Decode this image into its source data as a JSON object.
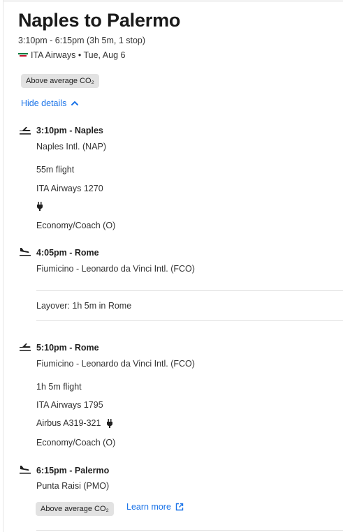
{
  "header": {
    "title": "Naples to Palermo",
    "time_summary": "3:10pm - 6:15pm (3h 5m, 1 stop)",
    "airline_date": "ITA Airways • Tue, Aug 6",
    "co2_badge": "Above average CO₂"
  },
  "details_toggle": {
    "label": "Hide details"
  },
  "segments": [
    {
      "departure": {
        "title": "3:10pm - Naples",
        "airport": "Naples Intl. (NAP)"
      },
      "duration": "55m flight",
      "flight": "ITA Airways 1270",
      "aircraft": "",
      "cabin": "Economy/Coach (O)",
      "arrival": {
        "title": "4:05pm - Rome",
        "airport": "Fiumicino - Leonardo da Vinci Intl. (FCO)"
      }
    },
    {
      "departure": {
        "title": "5:10pm - Rome",
        "airport": "Fiumicino - Leonardo da Vinci Intl. (FCO)"
      },
      "duration": "1h 5m flight",
      "flight": "ITA Airways 1795",
      "aircraft": "Airbus A319-321",
      "cabin": "Economy/Coach (O)",
      "arrival": {
        "title": "6:15pm - Palermo",
        "airport": "Punta Raisi (PMO)"
      }
    }
  ],
  "layover": "Layover: 1h 5m in Rome",
  "footer": {
    "co2_badge": "Above average CO₂",
    "learn_more": "Learn more"
  },
  "colors": {
    "link": "#1a73e8",
    "badge_bg": "#e2e2e2"
  }
}
